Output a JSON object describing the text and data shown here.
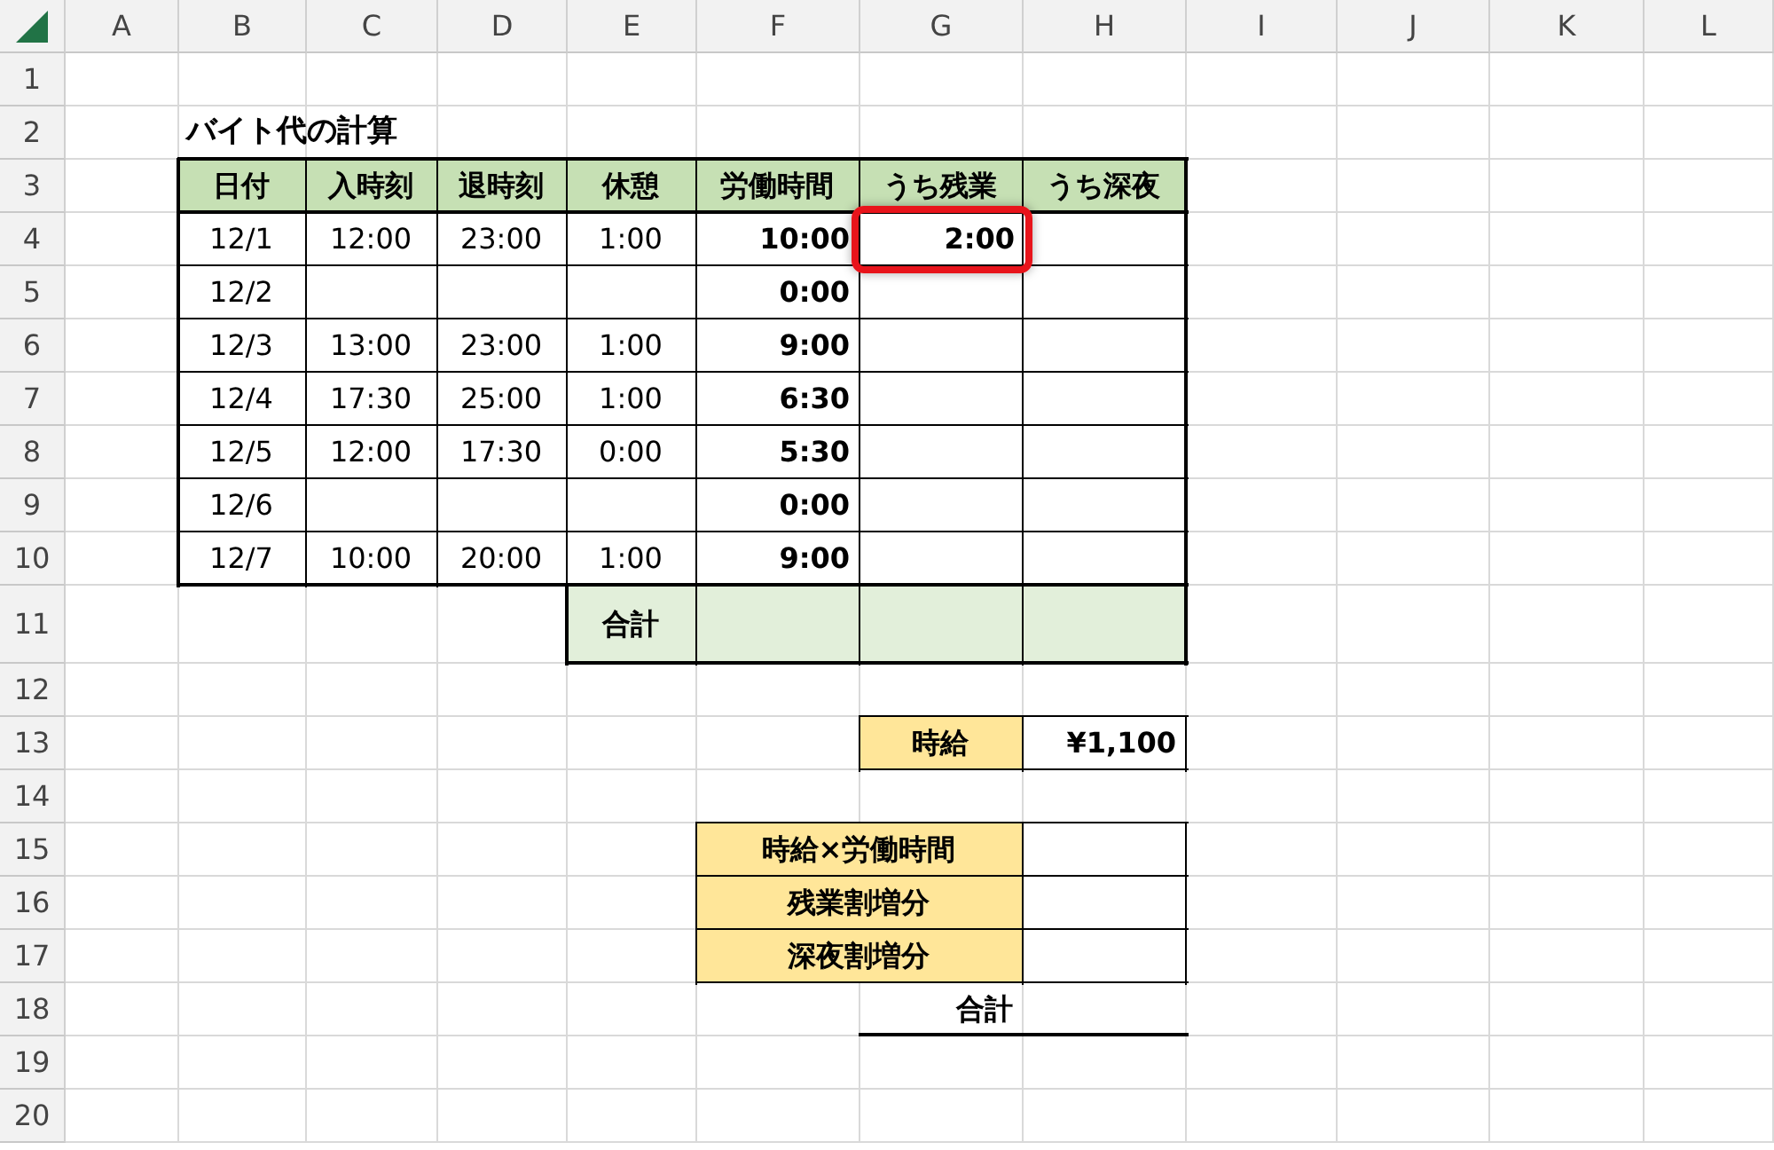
{
  "columns": [
    "A",
    "B",
    "C",
    "D",
    "E",
    "F",
    "G",
    "H",
    "I",
    "J",
    "K",
    "L"
  ],
  "row_numbers": [
    "1",
    "2",
    "3",
    "4",
    "5",
    "6",
    "7",
    "8",
    "9",
    "10",
    "11",
    "12",
    "13",
    "14",
    "15",
    "16",
    "17",
    "18",
    "19",
    "20"
  ],
  "title": "バイト代の計算",
  "table": {
    "headers": [
      "日付",
      "入時刻",
      "退時刻",
      "休憩",
      "労働時間",
      "うち残業",
      "うち深夜"
    ],
    "rows": [
      {
        "cells": [
          {
            "text": "12/1",
            "highlighted": false
          },
          {
            "text": "12:00",
            "highlighted": false
          },
          {
            "text": "23:00",
            "highlighted": false
          },
          {
            "text": "1:00",
            "highlighted": false
          },
          {
            "text": "10:00",
            "highlighted": false
          },
          {
            "text": "2:00",
            "highlighted": true
          },
          null
        ]
      },
      {
        "cells": [
          {
            "text": "12/2",
            "highlighted": false
          },
          null,
          null,
          null,
          {
            "text": "0:00",
            "highlighted": false
          },
          null,
          null
        ]
      },
      {
        "cells": [
          {
            "text": "12/3",
            "highlighted": false
          },
          {
            "text": "13:00",
            "highlighted": false
          },
          {
            "text": "23:00",
            "highlighted": false
          },
          {
            "text": "1:00",
            "highlighted": false
          },
          {
            "text": "9:00",
            "highlighted": false
          },
          null,
          null
        ]
      },
      {
        "cells": [
          {
            "text": "12/4",
            "highlighted": false
          },
          {
            "text": "17:30",
            "highlighted": false
          },
          {
            "text": "25:00",
            "highlighted": false
          },
          {
            "text": "1:00",
            "highlighted": false
          },
          {
            "text": "6:30",
            "highlighted": false
          },
          null,
          null
        ]
      },
      {
        "cells": [
          {
            "text": "12/5",
            "highlighted": false
          },
          {
            "text": "12:00",
            "highlighted": false
          },
          {
            "text": "17:30",
            "highlighted": false
          },
          {
            "text": "0:00",
            "highlighted": false
          },
          {
            "text": "5:30",
            "highlighted": false
          },
          null,
          null
        ]
      },
      {
        "cells": [
          {
            "text": "12/6",
            "highlighted": false
          },
          null,
          null,
          null,
          {
            "text": "0:00",
            "highlighted": false
          },
          null,
          null
        ]
      },
      {
        "cells": [
          {
            "text": "12/7",
            "highlighted": false
          },
          {
            "text": "10:00",
            "highlighted": false
          },
          {
            "text": "20:00",
            "highlighted": false
          },
          {
            "text": "1:00",
            "highlighted": false
          },
          {
            "text": "9:00",
            "highlighted": false
          },
          null,
          null
        ]
      }
    ],
    "total_label": "合計"
  },
  "hourly_wage": {
    "label": "時給",
    "value": "¥1,100"
  },
  "summary": {
    "rows": [
      {
        "label": "時給×労働時間"
      },
      {
        "label": "残業割増分"
      },
      {
        "label": "深夜割増分"
      }
    ],
    "total_label": "合計"
  }
}
